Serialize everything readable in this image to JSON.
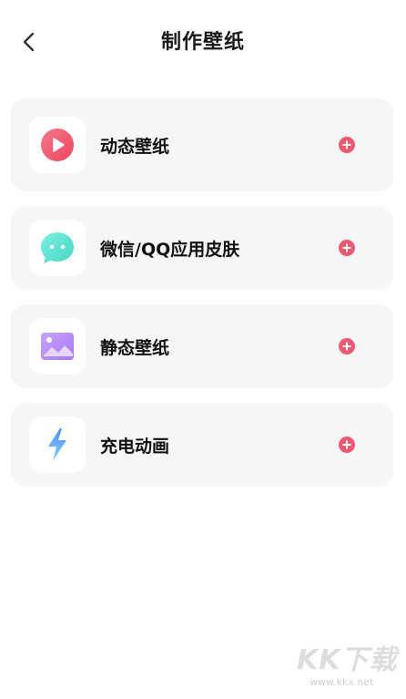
{
  "header": {
    "title": "制作壁纸",
    "back_icon": "chevron-left-icon"
  },
  "items": [
    {
      "label": "动态壁纸",
      "icon": "play-circle-icon",
      "icon_color": "#f25a6c",
      "action_icon": "add-circle-icon"
    },
    {
      "label": "微信/QQ应用皮肤",
      "icon": "chat-bubble-icon",
      "icon_color": "#5fe0cf",
      "action_icon": "add-circle-icon"
    },
    {
      "label": "静态壁纸",
      "icon": "image-icon",
      "icon_color": "#b78cf6",
      "action_icon": "add-circle-icon"
    },
    {
      "label": "充电动画",
      "icon": "lightning-icon",
      "icon_color": "#4e9bf5",
      "action_icon": "add-circle-icon"
    }
  ],
  "colors": {
    "accent": "#ec5a72",
    "card_background": "#f6f6f6"
  },
  "watermark": {
    "logo": "KK下载",
    "url": "www.kkx.net"
  }
}
